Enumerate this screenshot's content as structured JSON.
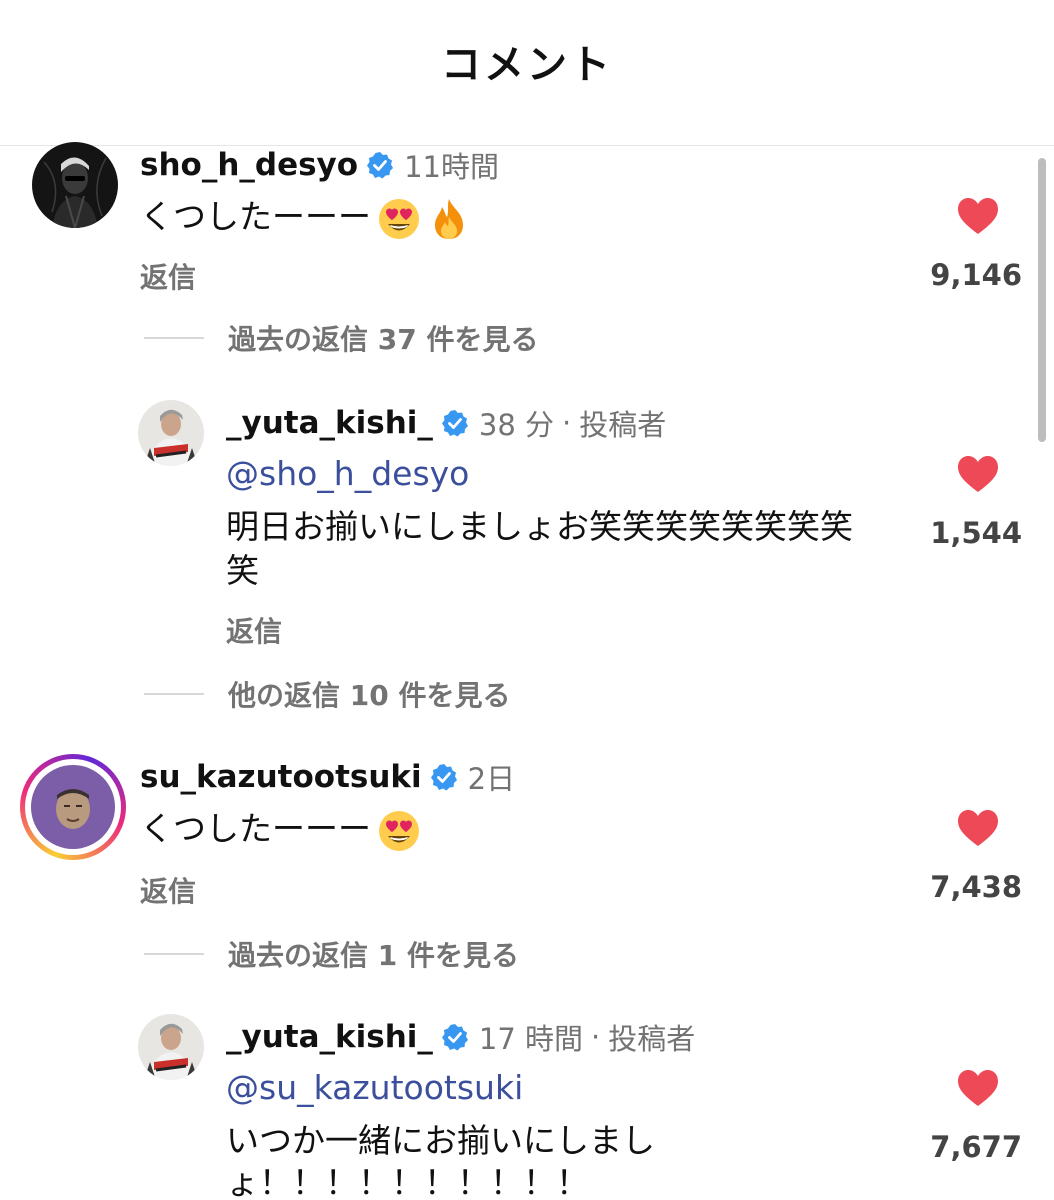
{
  "header": {
    "title": "コメント"
  },
  "comments": [
    {
      "username": "sho_h_desyo",
      "time": "11時間",
      "text": "くつしたーーー",
      "emojis": [
        "heart-eyes-emoji",
        "fire-emoji"
      ],
      "reply_label": "返信",
      "likes": "9,146",
      "view_replies": "過去の返信 37 件を見る",
      "reply": {
        "username": "_yuta_kishi_",
        "time": "38 分",
        "author_tag": "投稿者",
        "mention": "@sho_h_desyo",
        "text_line1": "明日お揃いにしましょお笑笑笑笑笑笑笑笑",
        "text_line2": "笑",
        "reply_label": "返信",
        "likes": "1,544"
      },
      "other_replies": "他の返信 10 件を見る"
    },
    {
      "username": "su_kazutootsuki",
      "time": "2日",
      "text": "くつしたーーー",
      "emojis": [
        "heart-eyes-emoji"
      ],
      "reply_label": "返信",
      "likes": "7,438",
      "view_replies": "過去の返信 1 件を見る",
      "reply": {
        "username": "_yuta_kishi_",
        "time": "17 時間",
        "author_tag": "投稿者",
        "mention": "@su_kazutootsuki",
        "text_line1": "いつか一緒にお揃いにしまし",
        "text_line2": "ょ！！！！！！！！！！",
        "likes": "7,677"
      }
    }
  ],
  "colors": {
    "heart": "#ed4956",
    "verified": "#3897f0",
    "mention": "#3b4f9c",
    "secondary_text": "#737373"
  }
}
